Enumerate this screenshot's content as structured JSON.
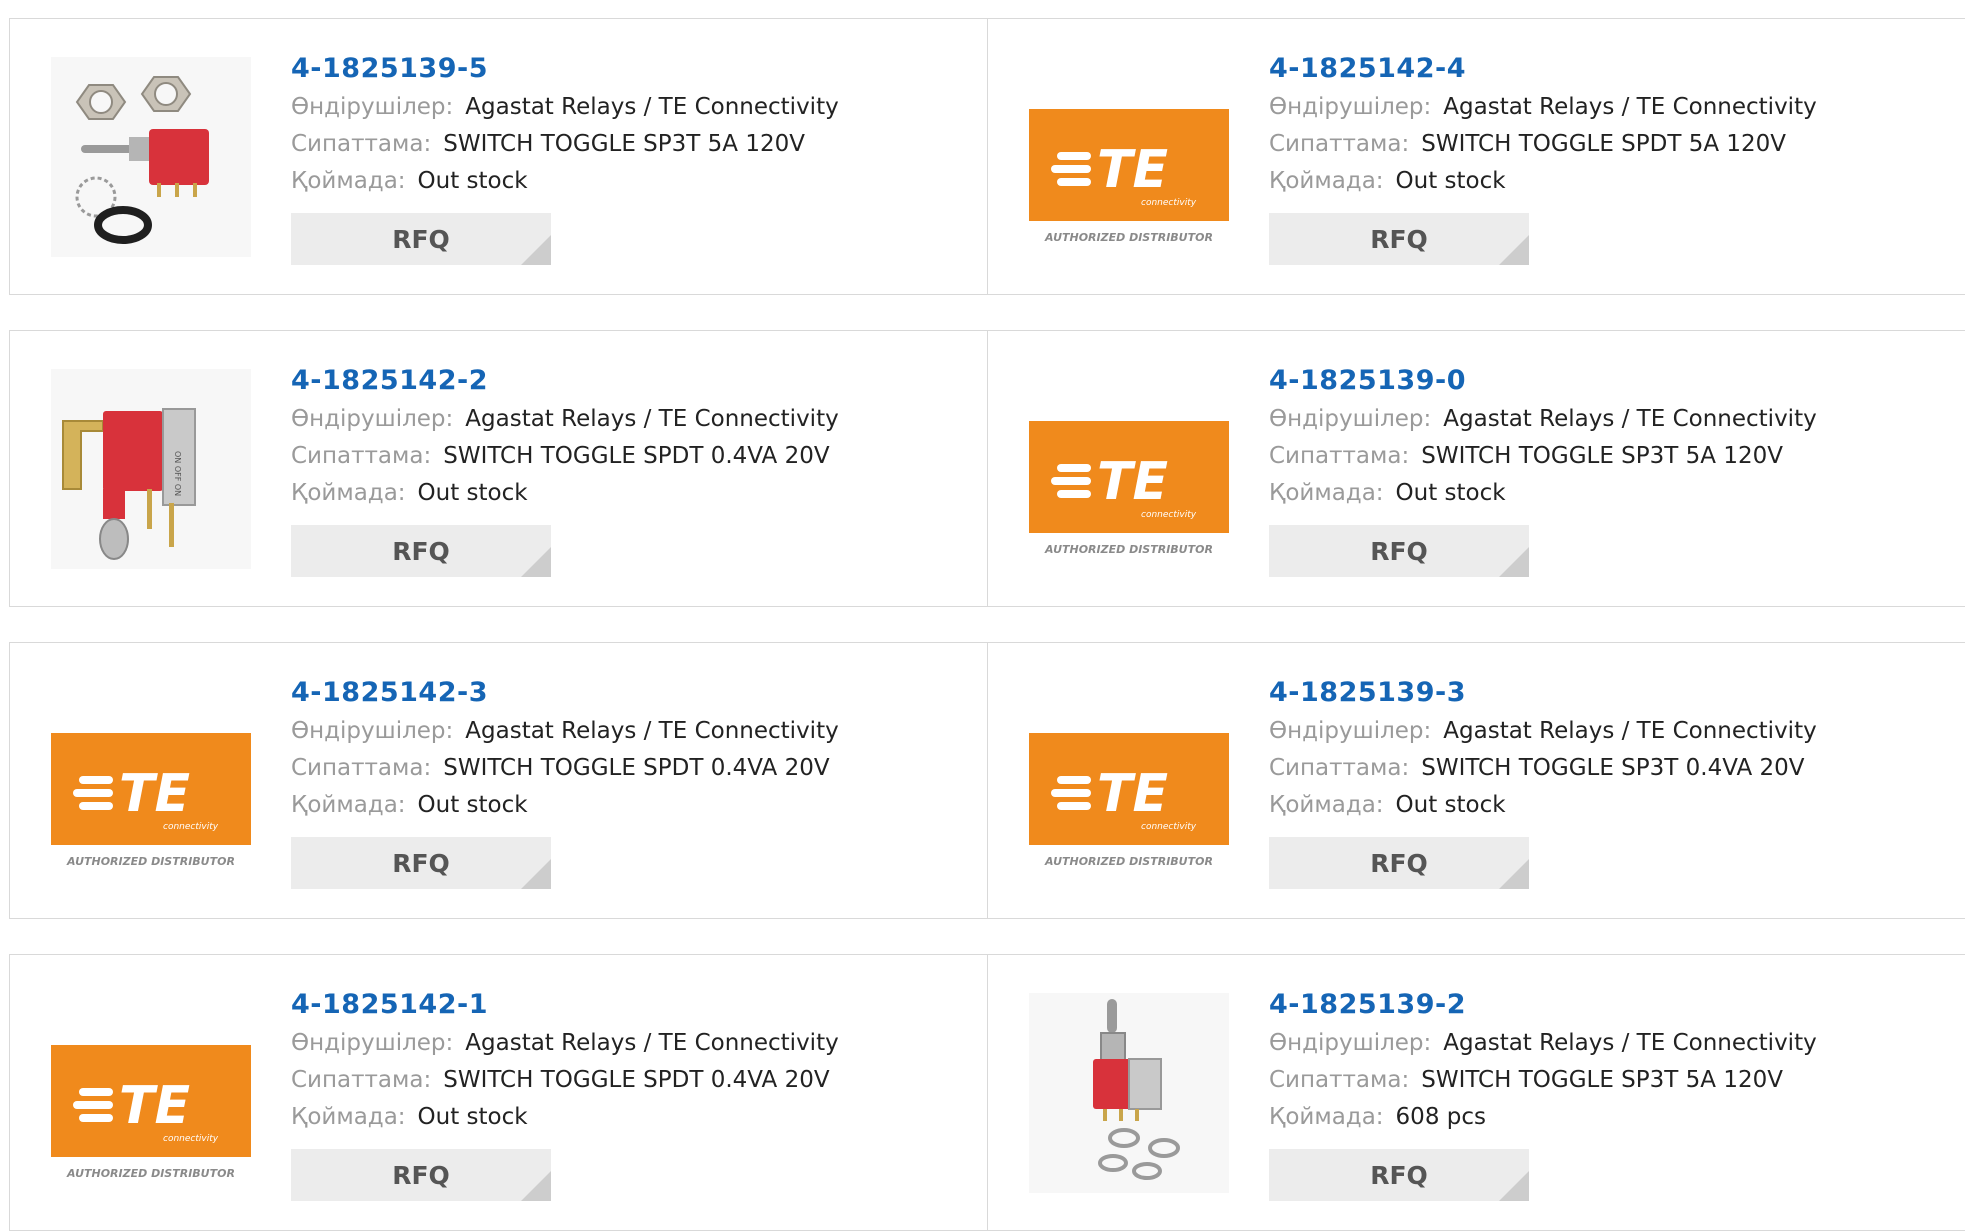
{
  "labels": {
    "manufacturer": "Өндірушілер:",
    "description": "Сипаттама:",
    "stock": "Қоймада:",
    "rfq": "RFQ"
  },
  "te_logo": {
    "text": "TE",
    "sub": "connectivity",
    "caption": "AUTHORIZED DISTRIBUTOR",
    "color": "#f08a1c"
  },
  "products": [
    {
      "part": "4-1825139-5",
      "manufacturer": "Agastat Relays / TE Connectivity",
      "description": "SWITCH TOGGLE SP3T 5A 120V",
      "stock": "Out stock",
      "image": "toggle-switch-kit-photo"
    },
    {
      "part": "4-1825142-4",
      "manufacturer": "Agastat Relays / TE Connectivity",
      "description": "SWITCH TOGGLE SPDT 5A 120V",
      "stock": "Out stock",
      "image": "te-logo"
    },
    {
      "part": "4-1825142-2",
      "manufacturer": "Agastat Relays / TE Connectivity",
      "description": "SWITCH TOGGLE SPDT 0.4VA 20V",
      "stock": "Out stock",
      "image": "right-angle-toggle-photo"
    },
    {
      "part": "4-1825139-0",
      "manufacturer": "Agastat Relays / TE Connectivity",
      "description": "SWITCH TOGGLE SP3T 5A 120V",
      "stock": "Out stock",
      "image": "te-logo"
    },
    {
      "part": "4-1825142-3",
      "manufacturer": "Agastat Relays / TE Connectivity",
      "description": "SWITCH TOGGLE SPDT 0.4VA 20V",
      "stock": "Out stock",
      "image": "te-logo"
    },
    {
      "part": "4-1825139-3",
      "manufacturer": "Agastat Relays / TE Connectivity",
      "description": "SWITCH TOGGLE SP3T 0.4VA 20V",
      "stock": "Out stock",
      "image": "te-logo"
    },
    {
      "part": "4-1825142-1",
      "manufacturer": "Agastat Relays / TE Connectivity",
      "description": "SWITCH TOGGLE SPDT 0.4VA 20V",
      "stock": "Out stock",
      "image": "te-logo"
    },
    {
      "part": "4-1825139-2",
      "manufacturer": "Agastat Relays / TE Connectivity",
      "description": "SWITCH TOGGLE SP3T 5A 120V",
      "stock": "608 pcs",
      "image": "vertical-toggle-photo"
    }
  ]
}
